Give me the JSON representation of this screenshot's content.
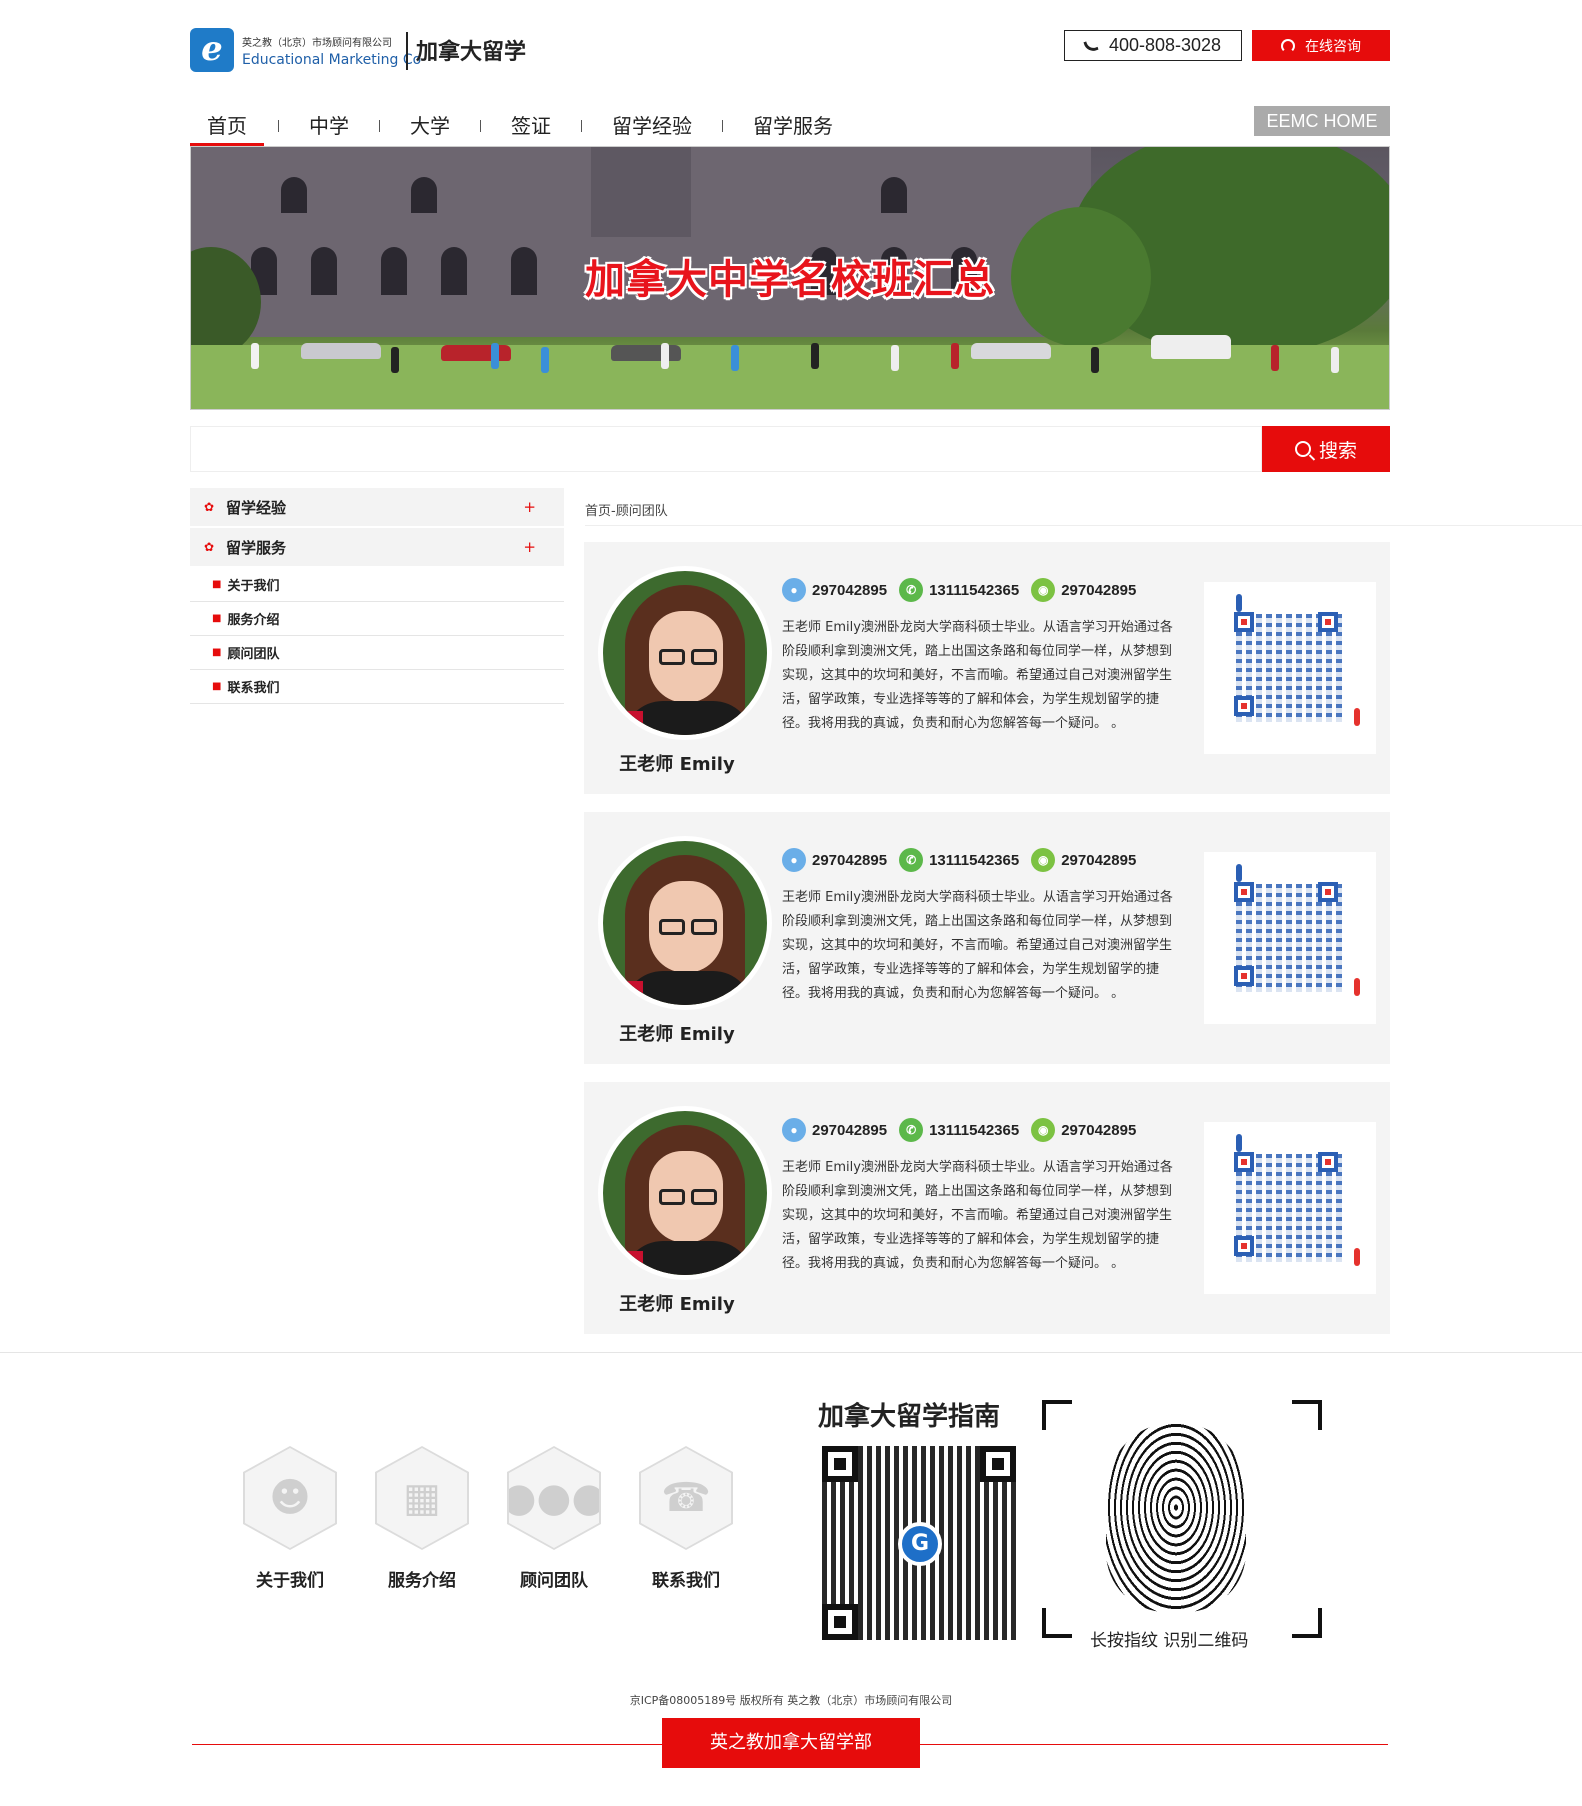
{
  "header": {
    "logo_letter": "e",
    "logo_company_cn": "英之教（北京）市场顾问有限公司",
    "logo_company_en": "Educational Marketing Co",
    "site_title": "加拿大留学",
    "phone": "400-808-3028",
    "consult_label": "在线咨询"
  },
  "nav": {
    "items": [
      {
        "label": "首页"
      },
      {
        "label": "中学"
      },
      {
        "label": "大学"
      },
      {
        "label": "签证"
      },
      {
        "label": "留学经验"
      },
      {
        "label": "留学服务"
      }
    ],
    "active_index": 0,
    "eemc_home": "EEMC HOME"
  },
  "banner": {
    "title": "加拿大中学名校班汇总"
  },
  "search": {
    "placeholder": "",
    "button_label": "搜索"
  },
  "sidebar": {
    "groups": [
      {
        "label": "留学经验",
        "toggle": "+"
      },
      {
        "label": "留学服务",
        "toggle": "+"
      }
    ],
    "sub_items": [
      {
        "label": "关于我们"
      },
      {
        "label": "服务介绍"
      },
      {
        "label": "顾问团队"
      },
      {
        "label": "联系我们"
      }
    ]
  },
  "breadcrumb": "首页-顾问团队",
  "consultants": [
    {
      "name": "王老师 Emily",
      "qq": "297042895",
      "whatsapp": "13111542365",
      "wechat": "297042895",
      "description": "王老师 Emily澳洲卧龙岗大学商科硕士毕业。从语言学习开始通过各阶段顺利拿到澳洲文凭，踏上出国这条路和每位同学一样，从梦想到实现，这其中的坎坷和美好，不言而喻。希望通过自己对澳洲留学生活，留学政策，专业选择等等的了解和体会，为学生规划留学的捷径。我将用我的真诚，负责和耐心为您解答每一个疑问。 。"
    },
    {
      "name": "王老师 Emily",
      "qq": "297042895",
      "whatsapp": "13111542365",
      "wechat": "297042895",
      "description": "王老师 Emily澳洲卧龙岗大学商科硕士毕业。从语言学习开始通过各阶段顺利拿到澳洲文凭，踏上出国这条路和每位同学一样，从梦想到实现，这其中的坎坷和美好，不言而喻。希望通过自己对澳洲留学生活，留学政策，专业选择等等的了解和体会，为学生规划留学的捷径。我将用我的真诚，负责和耐心为您解答每一个疑问。 。"
    },
    {
      "name": "王老师 Emily",
      "qq": "297042895",
      "whatsapp": "13111542365",
      "wechat": "297042895",
      "description": "王老师 Emily澳洲卧龙岗大学商科硕士毕业。从语言学习开始通过各阶段顺利拿到澳洲文凭，踏上出国这条路和每位同学一样，从梦想到实现，这其中的坎坷和美好，不言而喻。希望通过自己对澳洲留学生活，留学政策，专业选择等等的了解和体会，为学生规划留学的捷径。我将用我的真诚，负责和耐心为您解答每一个疑问。 。"
    }
  ],
  "footer": {
    "links": [
      {
        "label": "关于我们",
        "icon": "users-icon"
      },
      {
        "label": "服务介绍",
        "icon": "meeting-icon"
      },
      {
        "label": "顾问团队",
        "icon": "team-icon"
      },
      {
        "label": "联系我们",
        "icon": "phone-icon"
      }
    ],
    "guide_title": "加拿大留学指南",
    "qr_logo_letter": "G",
    "fingerprint_caption": "长按指纹 识别二维码",
    "icp": "京ICP备08005189号 版权所有 英之教（北京）市场顾问有限公司",
    "bottom_tag": "英之教加拿大留学部"
  },
  "colors": {
    "accent": "#e60c0c",
    "logo_blue": "#1f7bc8",
    "card_bg": "#f4f4f4"
  }
}
